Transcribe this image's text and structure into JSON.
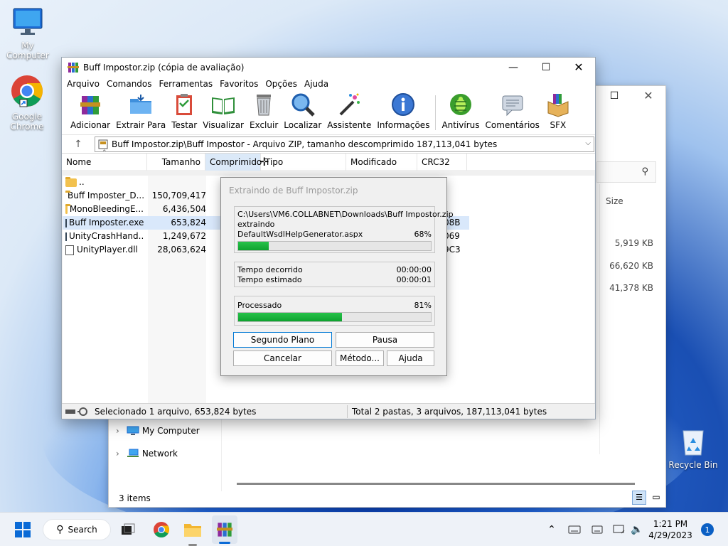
{
  "desktop": {
    "icons": [
      {
        "label": "My Computer"
      },
      {
        "label": "Google Chrome"
      },
      {
        "label": "Recycle Bin"
      }
    ]
  },
  "explorer": {
    "search_icon": "search-icon",
    "size_header": "Size",
    "sizes": [
      "5,919 KB",
      "66,620 KB",
      "41,378 KB"
    ],
    "nav": [
      {
        "label": "My Computer"
      },
      {
        "label": "Network"
      }
    ],
    "status": "3 items"
  },
  "winrar": {
    "title": "Buff Impostor.zip (cópia de avaliação)",
    "menu": [
      "Arquivo",
      "Comandos",
      "Ferramentas",
      "Favoritos",
      "Opções",
      "Ajuda"
    ],
    "toolbar": [
      {
        "label": "Adicionar",
        "icon": "books-archive-icon"
      },
      {
        "label": "Extrair Para",
        "icon": "folder-extract-icon"
      },
      {
        "label": "Testar",
        "icon": "clipboard-check-icon"
      },
      {
        "label": "Visualizar",
        "icon": "open-book-icon"
      },
      {
        "label": "Excluir",
        "icon": "trash-can-icon"
      },
      {
        "label": "Localizar",
        "icon": "magnifier-icon"
      },
      {
        "label": "Assistente",
        "icon": "magic-wand-icon"
      },
      {
        "label": "Informações",
        "icon": "info-icon"
      },
      {
        "label": "Antivírus",
        "icon": "bug-icon"
      },
      {
        "label": "Comentários",
        "icon": "comment-icon"
      },
      {
        "label": "SFX",
        "icon": "sfx-box-icon"
      }
    ],
    "address": "Buff Impostor.zip\\Buff Impostor - Arquivo ZIP, tamanho descomprimido 187,113,041 bytes",
    "columns": {
      "name": "Nome",
      "size": "Tamanho",
      "packed": "Comprimido",
      "type": "Tipo",
      "modified": "Modificado",
      "crc": "CRC32"
    },
    "files": [
      {
        "name": "..",
        "size": "",
        "crc": "",
        "kind": "folder"
      },
      {
        "name": "Buff Imposter_D...",
        "size": "150,709,417",
        "crc": "",
        "kind": "folder"
      },
      {
        "name": "MonoBleedingE...",
        "size": "6,436,504",
        "crc": "",
        "kind": "folder"
      },
      {
        "name": "Buff Imposter.exe",
        "size": "653,824",
        "crc": "08B",
        "kind": "exe"
      },
      {
        "name": "UnityCrashHand...",
        "size": "1,249,672",
        "crc": "069",
        "kind": "exe"
      },
      {
        "name": "UnityPlayer.dll",
        "size": "28,063,624",
        "crc": "9C3",
        "kind": "file"
      }
    ],
    "status_left": "Selecionado 1 arquivo, 653,824 bytes",
    "status_right": "Total 2 pastas, 3 arquivos, 187,113,041 bytes"
  },
  "dialog": {
    "title": "Extraindo de Buff Impostor.zip",
    "path": "C:\\Users\\VM6.COLLABNET\\Downloads\\Buff Impostor.zip",
    "action": "extraindo",
    "current_file": "DefaultWsdlHelpGenerator.aspx",
    "file_percent": "68%",
    "file_progress": 0.16,
    "elapsed_label": "Tempo decorrido",
    "elapsed": "00:00:00",
    "estimated_label": "Tempo estimado",
    "estimated": "00:00:01",
    "processed_label": "Processado",
    "processed_percent": "81%",
    "processed_progress": 0.54,
    "buttons": {
      "background": "Segundo Plano",
      "pause": "Pausa",
      "cancel": "Cancelar",
      "method": "Método...",
      "help": "Ajuda"
    }
  },
  "taskbar": {
    "search": "Search",
    "time": "1:21 PM",
    "date": "4/29/2023",
    "notification_count": "1"
  }
}
